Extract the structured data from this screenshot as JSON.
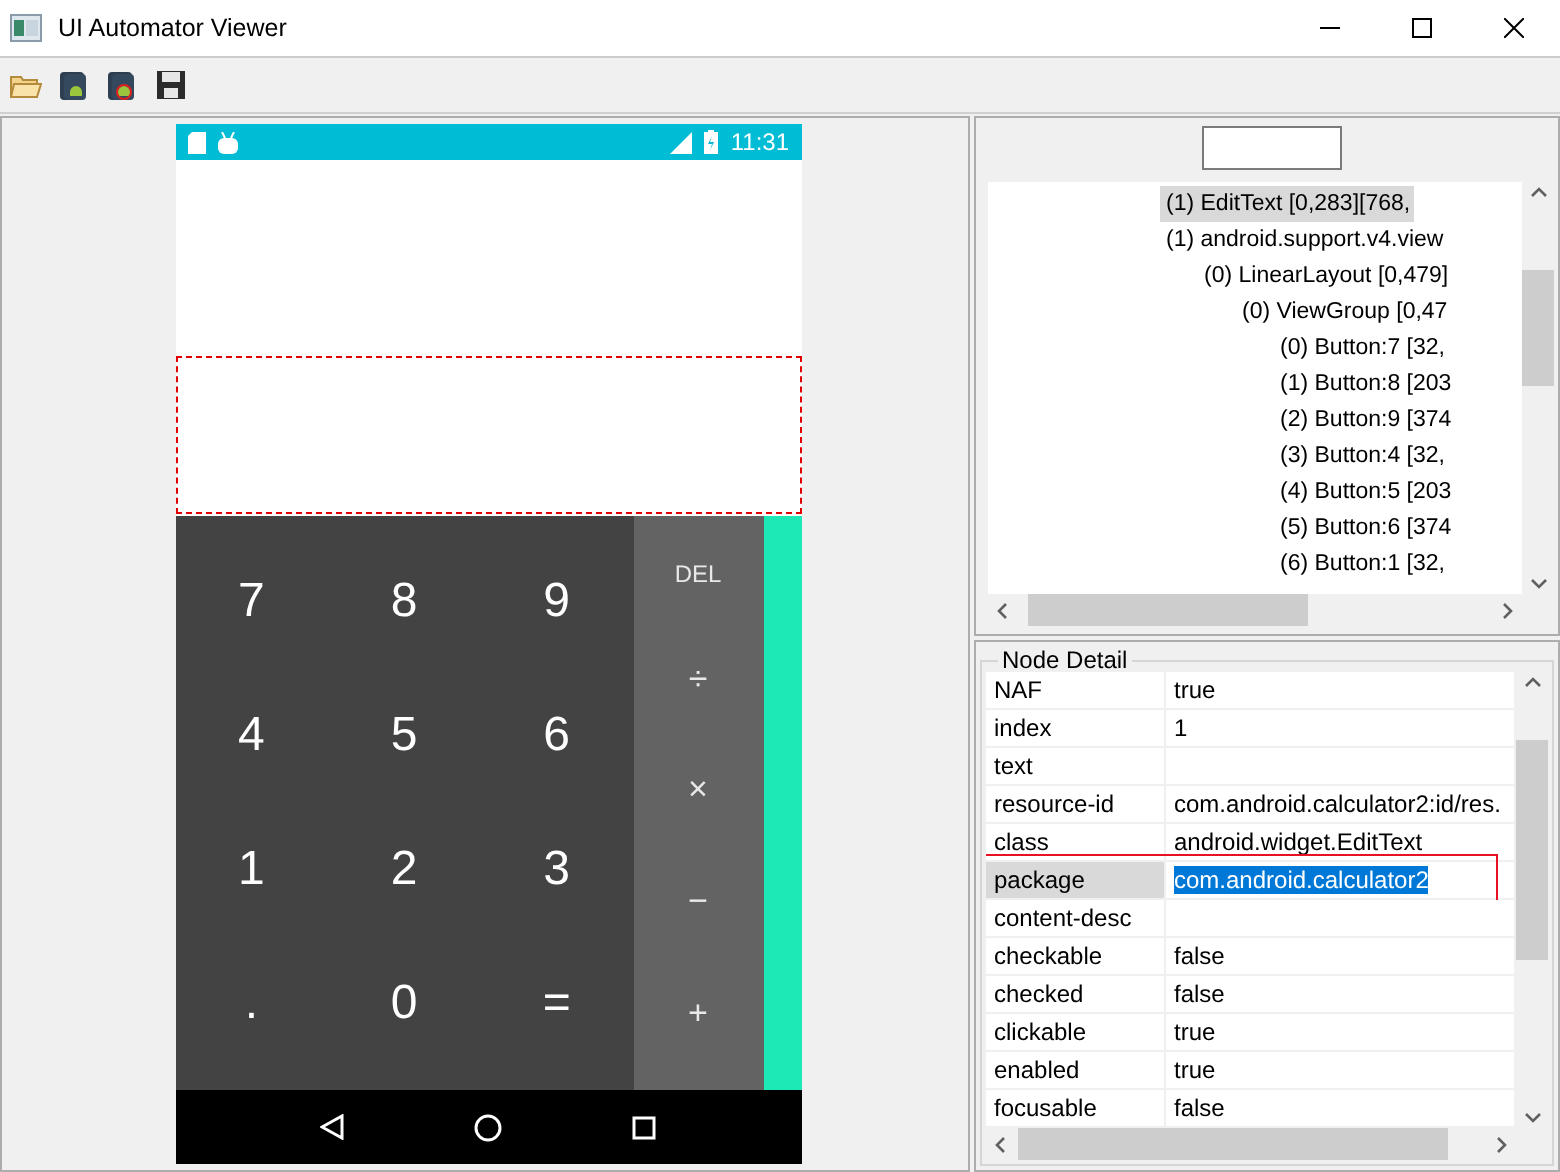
{
  "window": {
    "title": "UI Automator Viewer"
  },
  "phone": {
    "status_time": "11:31",
    "keypad": {
      "digits": [
        [
          "7",
          "8",
          "9"
        ],
        [
          "4",
          "5",
          "6"
        ],
        [
          "1",
          "2",
          "3"
        ],
        [
          ".",
          "0",
          "="
        ]
      ],
      "operators": [
        "DEL",
        "÷",
        "×",
        "−",
        "+"
      ]
    }
  },
  "tree": {
    "items": [
      {
        "label": "(1) EditText [0,283][768,",
        "selected": true
      },
      {
        "label": "(1) android.support.v4.view",
        "selected": false,
        "children": [
          {
            "label": "(0) LinearLayout [0,479]",
            "selected": false,
            "children": [
              {
                "label": "(0) ViewGroup [0,47",
                "selected": false,
                "children": [
                  {
                    "label": "(0) Button:7 [32,",
                    "selected": false
                  },
                  {
                    "label": "(1) Button:8 [203",
                    "selected": false
                  },
                  {
                    "label": "(2) Button:9 [374",
                    "selected": false
                  },
                  {
                    "label": "(3) Button:4 [32,",
                    "selected": false
                  },
                  {
                    "label": "(4) Button:5 [203",
                    "selected": false
                  },
                  {
                    "label": "(5) Button:6 [374",
                    "selected": false
                  },
                  {
                    "label": "(6) Button:1 [32,",
                    "selected": false
                  }
                ]
              }
            ]
          }
        ]
      }
    ]
  },
  "node_detail": {
    "title": "Node Detail",
    "rows": [
      {
        "key": "NAF",
        "value": "true",
        "selected": false
      },
      {
        "key": "index",
        "value": "1",
        "selected": false
      },
      {
        "key": "text",
        "selected": false
      },
      {
        "key": "resource-id",
        "value": "com.android.calculator2:id/res.",
        "selected": false
      },
      {
        "key": "class",
        "value": "android.widget.EditText",
        "selected": false
      },
      {
        "key": "package",
        "value": "com.android.calculator2",
        "selected": true
      },
      {
        "key": "content-desc",
        "selected": false
      },
      {
        "key": "checkable",
        "value": "false",
        "selected": false
      },
      {
        "key": "checked",
        "value": "false",
        "selected": false
      },
      {
        "key": "clickable",
        "value": "true",
        "selected": false
      },
      {
        "key": "enabled",
        "value": "true",
        "selected": false
      },
      {
        "key": "focusable",
        "value": "false",
        "selected": false
      }
    ]
  }
}
